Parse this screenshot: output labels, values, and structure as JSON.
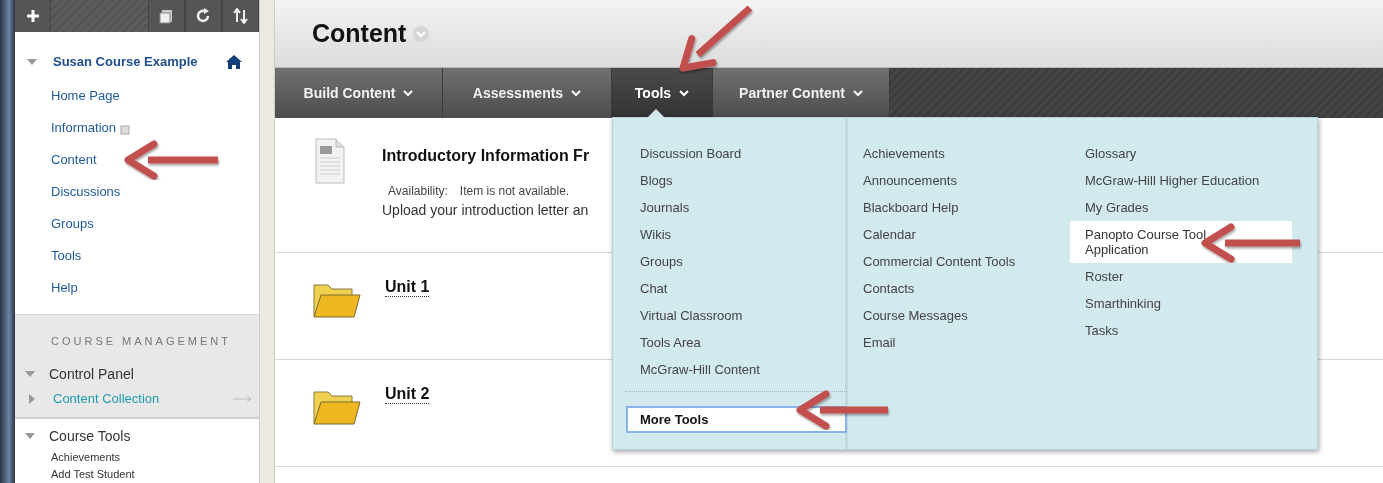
{
  "sidebar": {
    "course": {
      "title": "Susan Course Example",
      "expanded": true,
      "items": [
        {
          "label": "Home Page",
          "kind": "link"
        },
        {
          "label": "Information",
          "kind": "link_with_icon"
        },
        {
          "label": "Content",
          "kind": "link"
        },
        {
          "label": "Discussions",
          "kind": "link"
        },
        {
          "label": "Groups",
          "kind": "link"
        },
        {
          "label": "Tools",
          "kind": "link"
        },
        {
          "label": "Help",
          "kind": "link"
        }
      ]
    },
    "management": {
      "heading": "COURSE MANAGEMENT",
      "sections": [
        {
          "label": "Control Panel",
          "expanded": true,
          "children": [
            {
              "label": "Content Collection",
              "expanded": false
            }
          ]
        },
        {
          "label": "Course Tools",
          "expanded": true,
          "children": [
            {
              "label": "Achievements"
            },
            {
              "label": "Add Test Student"
            }
          ]
        }
      ]
    }
  },
  "main": {
    "title": "Content",
    "tabs": [
      {
        "label": "Build Content",
        "selected": false
      },
      {
        "label": "Assessments",
        "selected": false
      },
      {
        "label": "Tools",
        "selected": true
      },
      {
        "label": "Partner Content",
        "selected": false
      }
    ],
    "items": [
      {
        "kind": "document",
        "title": "Introductory Information Fr",
        "availability_label": "Availability:",
        "availability_value": "Item is not available.",
        "description": "Upload your introduction letter an"
      },
      {
        "kind": "folder",
        "title": "Unit 1"
      },
      {
        "kind": "folder",
        "title": "Unit 2"
      }
    ],
    "tools_menu": {
      "columns": [
        [
          {
            "label": "Discussion Board",
            "selected": false
          },
          {
            "label": "Blogs",
            "selected": false
          },
          {
            "label": "Journals",
            "selected": false
          },
          {
            "label": "Wikis",
            "selected": false
          },
          {
            "label": "Groups",
            "selected": false
          },
          {
            "label": "Chat",
            "selected": false
          },
          {
            "label": "Virtual Classroom",
            "selected": false
          },
          {
            "label": "Tools Area",
            "selected": false
          },
          {
            "label": "McGraw-Hill Content",
            "selected": false
          }
        ],
        [
          {
            "label": "Achievements",
            "selected": false
          },
          {
            "label": "Announcements",
            "selected": false
          },
          {
            "label": "Blackboard Help",
            "selected": false
          },
          {
            "label": "Calendar",
            "selected": false
          },
          {
            "label": "Commercial Content Tools",
            "selected": false
          },
          {
            "label": "Contacts",
            "selected": false
          },
          {
            "label": "Course Messages",
            "selected": false
          },
          {
            "label": "Email",
            "selected": false
          }
        ],
        [
          {
            "label": "Glossary",
            "selected": false
          },
          {
            "label": "McGraw-Hill Higher Education",
            "selected": false
          },
          {
            "label": "My Grades",
            "selected": false
          },
          {
            "label": "Panopto Course Tool Application",
            "selected": true
          },
          {
            "label": "Roster",
            "selected": false
          },
          {
            "label": "Smarthinking",
            "selected": false
          },
          {
            "label": "Tasks",
            "selected": false
          }
        ]
      ],
      "more_tools": {
        "label": "More Tools",
        "focused": true
      }
    }
  }
}
